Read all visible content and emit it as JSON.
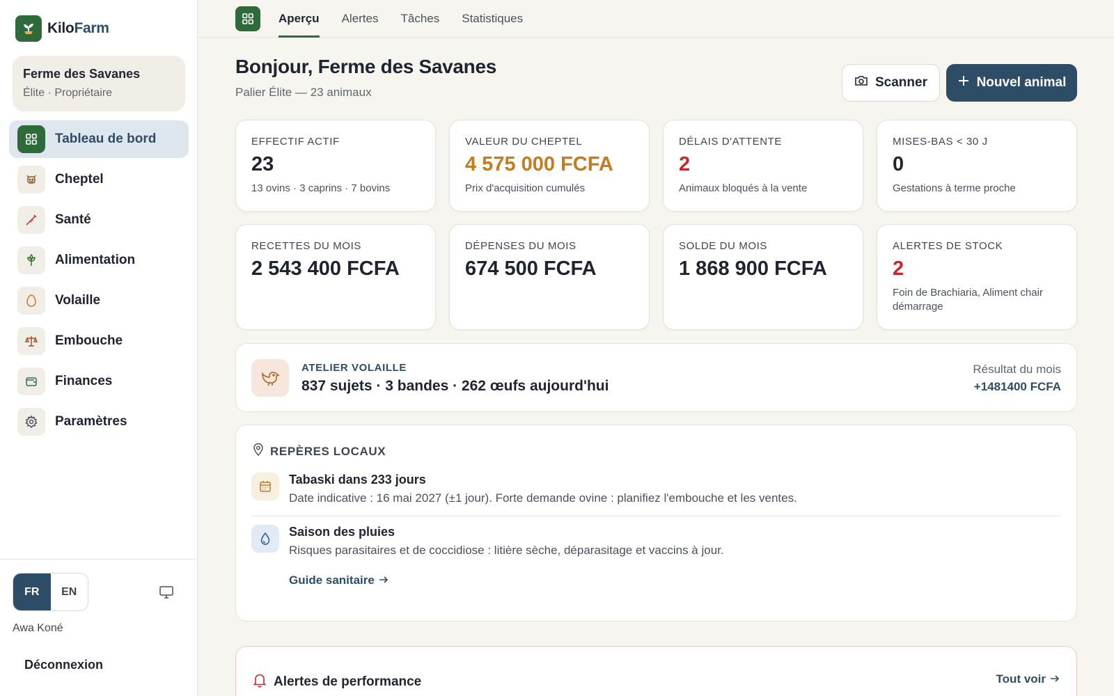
{
  "app": {
    "brand_part1": "Kilo",
    "brand_part2": "Farm",
    "colors": {
      "primary_green": "#2f6b3a",
      "primary_navy": "#2d4d66",
      "orange": "#c47c1e",
      "red": "#c9262b"
    }
  },
  "sidebar": {
    "farm_name": "Ferme des Savanes",
    "farm_role": "Élite · Propriétaire",
    "items": [
      {
        "label": "Tableau de bord",
        "icon": "dashboard-icon",
        "active": true
      },
      {
        "label": "Cheptel",
        "icon": "cow-icon"
      },
      {
        "label": "Santé",
        "icon": "syringe-icon"
      },
      {
        "label": "Alimentation",
        "icon": "wheat-icon"
      },
      {
        "label": "Volaille",
        "icon": "egg-icon"
      },
      {
        "label": "Embouche",
        "icon": "scale-icon"
      },
      {
        "label": "Finances",
        "icon": "wallet-icon"
      },
      {
        "label": "Paramètres",
        "icon": "gear-icon"
      }
    ],
    "lang": {
      "fr": "FR",
      "en": "EN",
      "active": "FR"
    },
    "user_name": "Awa Koné",
    "logout": "Déconnexion"
  },
  "tabs": [
    {
      "label": "Aperçu",
      "active": true
    },
    {
      "label": "Alertes"
    },
    {
      "label": "Tâches"
    },
    {
      "label": "Statistiques"
    }
  ],
  "header": {
    "greeting": "Bonjour, Ferme des Savanes",
    "subtitle": "Palier Élite — 23 animaux",
    "scan_button": "Scanner",
    "new_button": "Nouvel animal"
  },
  "stats": [
    {
      "label": "Effectif actif",
      "value": "23",
      "note": "13 ovins · 3 caprins · 7 bovins",
      "tone": "default"
    },
    {
      "label": "Valeur du cheptel",
      "value": "4 575 000 FCFA",
      "note": "Prix d'acquisition cumulés",
      "tone": "orange"
    },
    {
      "label": "Délais d'attente",
      "value": "2",
      "note": "Animaux bloqués à la vente",
      "tone": "red"
    },
    {
      "label": "Mises-bas < 30 j",
      "value": "0",
      "note": "Gestations à terme proche",
      "tone": "default"
    },
    {
      "label": "Recettes du mois",
      "value": "2 543 400 FCFA",
      "note": "",
      "tone": "default"
    },
    {
      "label": "Dépenses du mois",
      "value": "674 500 FCFA",
      "note": "",
      "tone": "default"
    },
    {
      "label": "Solde du mois",
      "value": "1 868 900 FCFA",
      "note": "",
      "tone": "default"
    },
    {
      "label": "Alertes de stock",
      "value": "2",
      "note": "Foin de Brachiaria, Aliment chair démarrage",
      "tone": "red"
    }
  ],
  "poultry": {
    "label": "ATELIER VOLAILLE",
    "summary": "837 sujets · 3 bandes · 262 œufs aujourd'hui",
    "result_label": "Résultat du mois",
    "result_value": "+1481400 FCFA"
  },
  "landmarks": {
    "title": "REPÈRES LOCAUX",
    "items": [
      {
        "title": "Tabaski dans 233 jours",
        "desc": "Date indicative : 16 mai 2027 (±1 jour). Forte demande ovine : planifiez l'embouche et les ventes.",
        "icon": "calendar-icon"
      },
      {
        "title": "Saison des pluies",
        "desc": "Risques parasitaires et de coccidiose : litière sèche, déparasitage et vaccins à jour.",
        "icon": "droplet-icon"
      }
    ],
    "link": "Guide sanitaire"
  },
  "alerts": {
    "title": "Alertes de performance",
    "link": "Tout voir"
  }
}
